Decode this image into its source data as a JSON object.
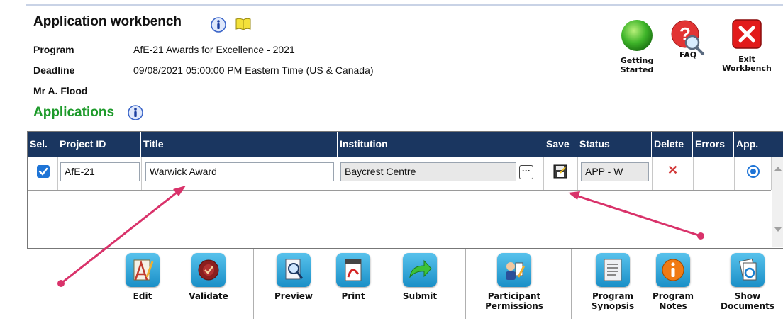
{
  "header": {
    "title": "Application workbench",
    "program_label": "Program",
    "program_value": "AfE-21  Awards for Excellence - 2021",
    "deadline_label": "Deadline",
    "deadline_value": "09/08/2021 05:00:00 PM Eastern Time (US & Canada)",
    "user_name": "Mr A. Flood"
  },
  "top_actions": {
    "getting_started": "Getting\nStarted",
    "faq": "FAQ",
    "exit": "Exit\nWorkbench"
  },
  "applications_heading": "Applications",
  "grid": {
    "columns": [
      "Sel.",
      "Project ID",
      "Title",
      "Institution",
      "Save",
      "Status",
      "Delete",
      "Errors",
      "App."
    ],
    "row": {
      "selected": true,
      "project_id": "AfE-21",
      "title": "Warwick Award",
      "institution": "Baycrest Centre",
      "status": "APP - W",
      "app_selected": true
    }
  },
  "toolbar": {
    "edit": "Edit",
    "validate": "Validate",
    "preview": "Preview",
    "print": "Print",
    "submit": "Submit",
    "participant_permissions": "Participant\nPermissions",
    "program_synopsis": "Program\nSynopsis",
    "program_notes": "Program\nNotes",
    "show_documents": "Show\nDocuments"
  },
  "colors": {
    "header_bar": "#1a3660",
    "heading_green": "#1d9a2a",
    "annotation_arrow": "#d9326a"
  }
}
